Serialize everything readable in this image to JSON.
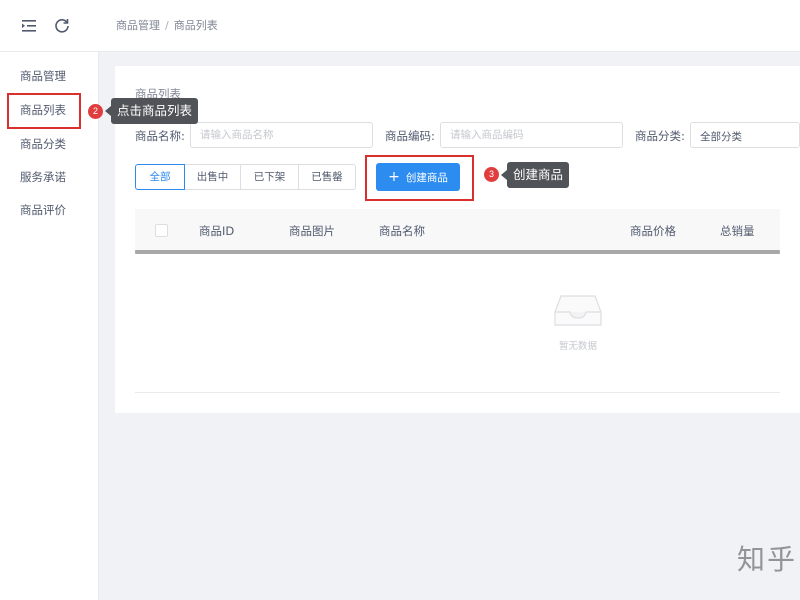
{
  "header": {
    "breadcrumb": [
      "商品管理",
      "商品列表"
    ],
    "breadcrumb_separator": "/",
    "menu_icon": "menu-fold-icon",
    "refresh_icon": "refresh-icon"
  },
  "sidebar": {
    "items": [
      {
        "label": "商品管理"
      },
      {
        "label": "商品列表"
      },
      {
        "label": "商品分类"
      },
      {
        "label": "服务承诺"
      },
      {
        "label": "商品评价"
      }
    ]
  },
  "annotations": {
    "step2": {
      "number": "2",
      "text": "点击商品列表"
    },
    "step3": {
      "number": "3",
      "text": "创建商品"
    },
    "highlight_color": "#d9302d"
  },
  "main": {
    "card_title": "商品列表",
    "filters": {
      "name_label": "商品名称:",
      "name_placeholder": "请输入商品名称",
      "code_label": "商品编码:",
      "code_placeholder": "请输入商品编码",
      "category_label": "商品分类:",
      "category_value": "全部分类"
    },
    "status_tabs": [
      "全部",
      "出售中",
      "已下架",
      "已售罄"
    ],
    "active_tab": "全部",
    "create_button": {
      "icon": "+",
      "label": "创建商品"
    },
    "table": {
      "columns": [
        "商品ID",
        "商品图片",
        "商品名称",
        "商品价格",
        "总销量"
      ],
      "rows": [],
      "empty_text": "暂无数据"
    }
  },
  "watermark": "知乎",
  "colors": {
    "primary": "#2d8cf0",
    "background": "#f0f2f5",
    "tooltip": "#505357",
    "badge": "#e03e3e"
  }
}
